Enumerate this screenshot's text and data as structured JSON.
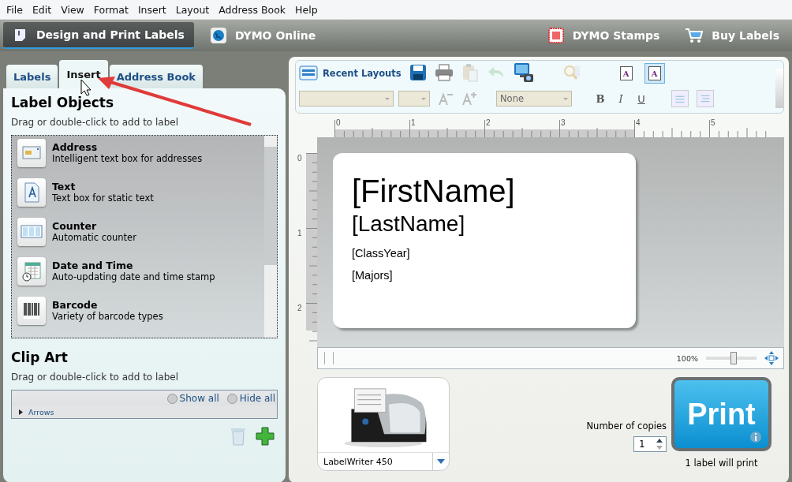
{
  "menu": [
    "File",
    "Edit",
    "View",
    "Format",
    "Insert",
    "Layout",
    "Address Book",
    "Help"
  ],
  "nav": {
    "left": [
      {
        "label": "Design and Print Labels",
        "kind": "labels",
        "selected": true
      },
      {
        "label": "DYMO Online",
        "kind": "globe",
        "selected": false
      }
    ],
    "right": [
      {
        "label": "DYMO Stamps",
        "kind": "stamps",
        "selected": false
      },
      {
        "label": "Buy Labels",
        "kind": "cart",
        "selected": false
      }
    ]
  },
  "tabs": [
    {
      "label": "Labels",
      "selected": false
    },
    {
      "label": "Insert",
      "selected": true
    },
    {
      "label": "Address Book",
      "selected": false
    }
  ],
  "label_objects": {
    "title": "Label Objects",
    "hint": "Drag or double-click to add to label",
    "items": [
      {
        "kind": "address",
        "name": "Address",
        "description": "Intelligent text box for addresses"
      },
      {
        "kind": "text",
        "name": "Text",
        "description": "Text box for static text"
      },
      {
        "kind": "counter",
        "name": "Counter",
        "description": "Automatic counter"
      },
      {
        "kind": "datetime",
        "name": "Date and Time",
        "description": "Auto-updating date and time stamp"
      },
      {
        "kind": "barcode",
        "name": "Barcode",
        "description": "Variety of barcode types"
      }
    ]
  },
  "clip_art": {
    "title": "Clip Art",
    "hint": "Drag or double-click to add to label",
    "show_all": "Show all",
    "hide_all": "Hide all",
    "categories": [
      {
        "label": "Arrows",
        "expanded": false
      }
    ]
  },
  "toolbar": {
    "recent_layouts": "Recent Layouts",
    "tools": [
      {
        "kind": "save",
        "disabled": false
      },
      {
        "kind": "print",
        "disabled": false
      },
      {
        "kind": "paste",
        "disabled": true
      },
      {
        "kind": "undo",
        "disabled": true
      },
      {
        "kind": "capture",
        "disabled": false
      },
      {
        "kind": "find",
        "disabled": true
      }
    ],
    "text_modes": [
      {
        "glyph": "A",
        "selected": false
      },
      {
        "glyph": "A",
        "selected": true
      }
    ],
    "effect": "None",
    "styles": [
      {
        "kind": "bold",
        "label": "B"
      },
      {
        "kind": "italic",
        "label": "I"
      },
      {
        "kind": "underline",
        "label": "U"
      }
    ]
  },
  "ruler": {
    "horizontal": [
      "0",
      "1",
      "2",
      "3",
      "4",
      "5"
    ],
    "vertical": [
      "0",
      "1",
      "2"
    ]
  },
  "label": {
    "lines": [
      {
        "kind": "large",
        "text": "[FirstName]"
      },
      {
        "kind": "medium",
        "text": "[LastName]"
      },
      {
        "kind": "small",
        "text": "[ClassYear]"
      },
      {
        "kind": "small",
        "text": "[Majors]"
      }
    ]
  },
  "zoom": {
    "reading": "100%",
    "level": 0.55
  },
  "printer": {
    "name": "LabelWriter 450"
  },
  "copies": {
    "label": "Number of copies",
    "value": "1"
  },
  "print": {
    "label": "Print",
    "status": "1 label will print"
  }
}
